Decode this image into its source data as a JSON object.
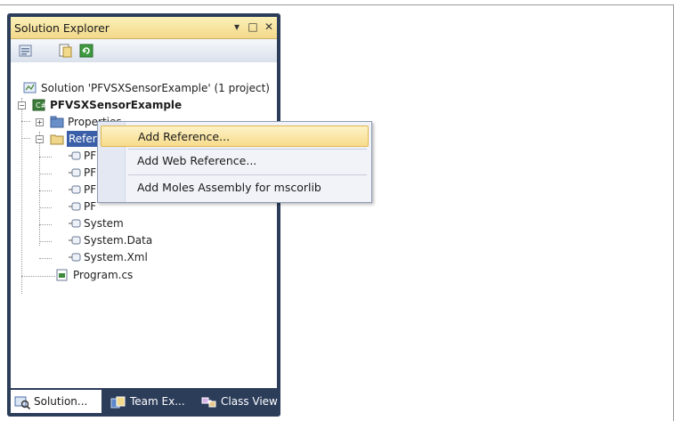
{
  "window": {
    "title": "Solution Explorer",
    "pin_glyph": "▾",
    "max_glyph": "□",
    "close_glyph": "✕"
  },
  "toolbar": {
    "icons": [
      "properties-icon",
      "show-all-files-icon",
      "refresh-icon"
    ]
  },
  "tree": {
    "solution": "Solution 'PFVSXSensorExample' (1 project)",
    "project": "PFVSXSensorExample",
    "properties": "Properties",
    "references": "Refer",
    "ref_items": [
      "PF",
      "PF",
      "PF",
      "PF",
      "System",
      "System.Data",
      "System.Xml"
    ],
    "program": "Program.cs"
  },
  "context_menu": {
    "items": [
      {
        "label": "Add Reference...",
        "state": "hover"
      },
      {
        "label": "Add Web Reference...",
        "state": "normal"
      },
      {
        "label": "Add Moles Assembly for mscorlib",
        "state": "normal"
      }
    ]
  },
  "tabs": [
    {
      "label": "Solution...",
      "active": true,
      "icon": "solution-explorer-icon"
    },
    {
      "label": "Team Ex...",
      "active": false,
      "icon": "team-explorer-icon"
    },
    {
      "label": "Class View",
      "active": false,
      "icon": "class-view-icon"
    }
  ],
  "colors": {
    "panel_border": "#2c3d5a",
    "title_gradient": "#f3d98a",
    "selection": "#3a5ea8",
    "menu_hover": "#f7dc8c"
  }
}
